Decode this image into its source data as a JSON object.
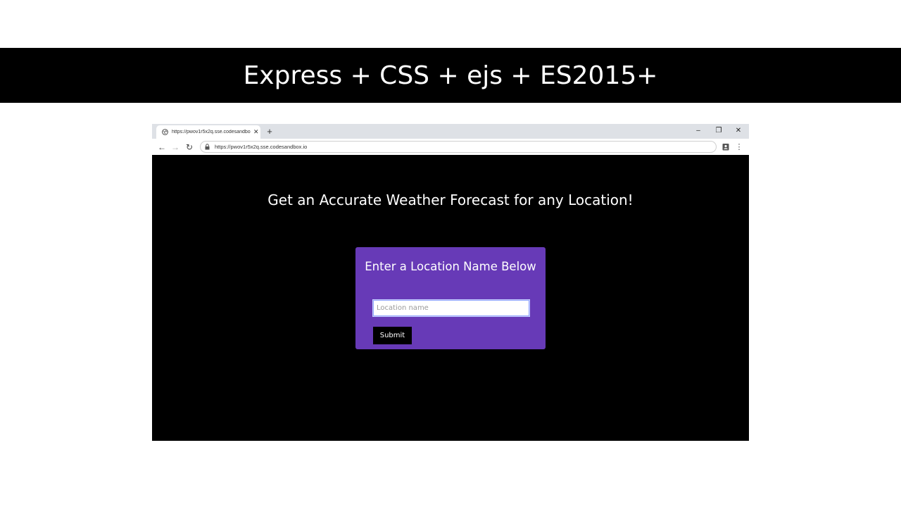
{
  "slide": {
    "title": "Express + CSS + ejs + ES2015+"
  },
  "browser": {
    "tab_title": "https://pwov1r5x2q.sse.codesandbox.io",
    "tab_close": "✕",
    "new_tab": "+",
    "window_controls": {
      "minimize": "–",
      "restore": "❐",
      "close": "✕"
    },
    "nav": {
      "back": "←",
      "forward": "→",
      "reload": "↻",
      "menu": "⋮"
    },
    "url": "https://pwov1r5x2q.sse.codesandbox.io"
  },
  "page": {
    "heading": "Get an Accurate Weather Forecast for any Location!",
    "card": {
      "title": "Enter a Location Name Below",
      "input_placeholder": "Location name",
      "input_value": "",
      "submit_label": "Submit"
    }
  },
  "colors": {
    "card_background": "#673ab7",
    "page_background": "#000000",
    "button_background": "#000000"
  }
}
